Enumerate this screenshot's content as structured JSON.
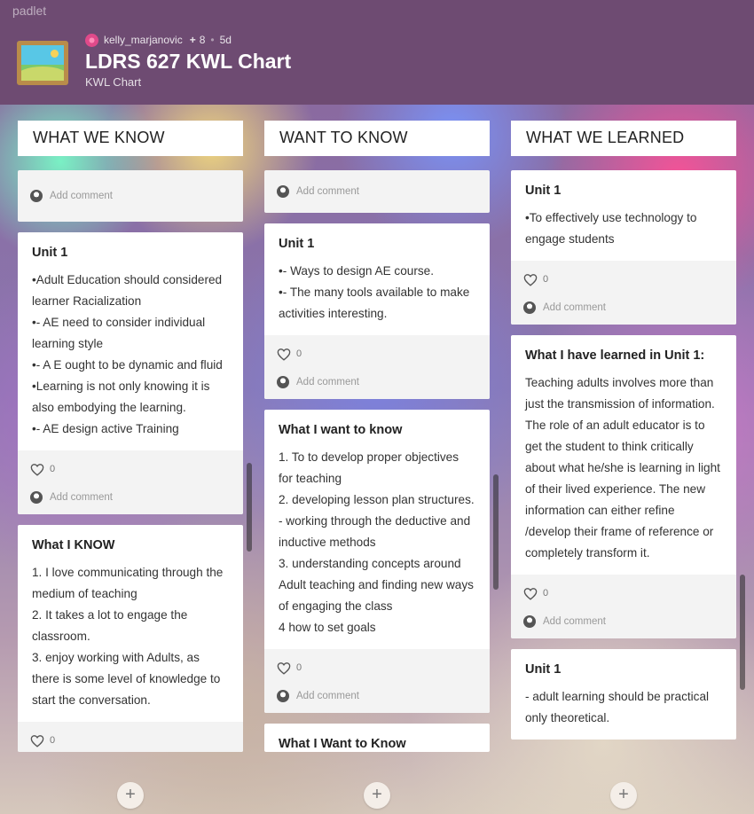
{
  "brand": "padlet",
  "header": {
    "author": "kelly_marjanovic",
    "plus": "+",
    "contributors": "8",
    "dot": "•",
    "age": "5d",
    "title": "LDRS 627 KWL Chart",
    "subtitle": "KWL Chart"
  },
  "labels": {
    "add_comment": "Add comment",
    "add_post": "+"
  },
  "columns": [
    {
      "title": "WHAT WE KNOW",
      "cards": [
        {
          "title": "",
          "body": "",
          "likes": ""
        },
        {
          "title": "Unit 1",
          "body": "•Adult Education should considered  learner Racialization\n•- AE  need to consider individual learning style\n•- A E ought to be dynamic and fluid\n•Learning is not only  knowing  it is also embodying the  learning.\n•- AE design active Training",
          "likes": "0"
        },
        {
          "title": "What I KNOW",
          "body": "1. I love communicating through the medium of teaching\n2. It takes a lot to engage the classroom.\n3. enjoy working with Adults,  as there is some level of knowledge to start the conversation.",
          "likes": "0"
        }
      ]
    },
    {
      "title": "WANT TO KNOW",
      "cards": [
        {
          "title": "",
          "body": "",
          "likes": ""
        },
        {
          "title": "Unit 1",
          "body": "•-  Ways to design AE course.\n•- The many tools available  to make activities interesting.",
          "likes": "0"
        },
        {
          "title": "What I want to know",
          "body": "1. To to develop proper objectives for teaching\n2. developing lesson plan structures.  - working through the deductive and inductive methods\n3. understanding concepts around Adult teaching  and finding new ways of engaging the class\n4 how to set goals",
          "likes": "0"
        },
        {
          "title": "What I Want to Know",
          "body": "",
          "likes": ""
        }
      ]
    },
    {
      "title": "WHAT WE LEARNED",
      "cards": [
        {
          "title": "Unit 1",
          "body": "•To effectively use technology to engage students",
          "likes": "0"
        },
        {
          "title": "What I have learned in Unit 1:",
          "body": "Teaching adults involves more than just the transmission of information. The role of an adult educator is to get the student to think critically about what he/she is learning in light of their lived experience. The new information can either refine /develop their frame of reference or completely transform it.",
          "likes": "0"
        },
        {
          "title": "Unit 1",
          "body": "- adult learning should be practical only theoretical.",
          "likes": ""
        }
      ]
    }
  ]
}
